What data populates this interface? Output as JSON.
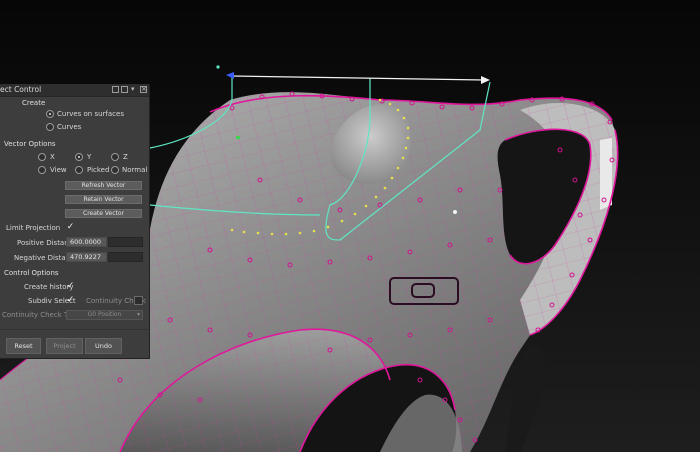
{
  "panel": {
    "title": "ect Control",
    "create": {
      "header": "Create",
      "options": [
        "Curves on surfaces",
        "Curves"
      ],
      "selected": "Curves on surfaces"
    },
    "vector_options": {
      "header": "Vector Options",
      "axis_options": [
        "X",
        "Y",
        "Z"
      ],
      "mode_options": [
        "View",
        "Picked",
        "Normal"
      ],
      "selected": "Y",
      "buttons": [
        "Refresh Vector",
        "Retain Vector",
        "Create Vector"
      ]
    },
    "limit_projection_label": "Limit Projection",
    "positive_distance": {
      "label": "Positive Distance",
      "value": "600.0000"
    },
    "negative_distance": {
      "label": "Negative Distance",
      "value": "470.9227"
    },
    "control_options": {
      "header": "Control Options",
      "create_history_label": "Create history",
      "subdiv_select_label": "Subdiv Select",
      "continuity_check_label": "Continuity Check",
      "continuity_check_type_label": "Continuity Check Type",
      "continuity_check_type_value": "G0 Position"
    },
    "footer": {
      "reset": "Reset",
      "project": "Project",
      "undo": "Undo"
    }
  },
  "colors": {
    "accent_magenta": "#e0179c",
    "curve_cyan": "#5fe6c4",
    "projection_yellow": "#e8e04a",
    "panel_bg": "#3d3d3d"
  }
}
